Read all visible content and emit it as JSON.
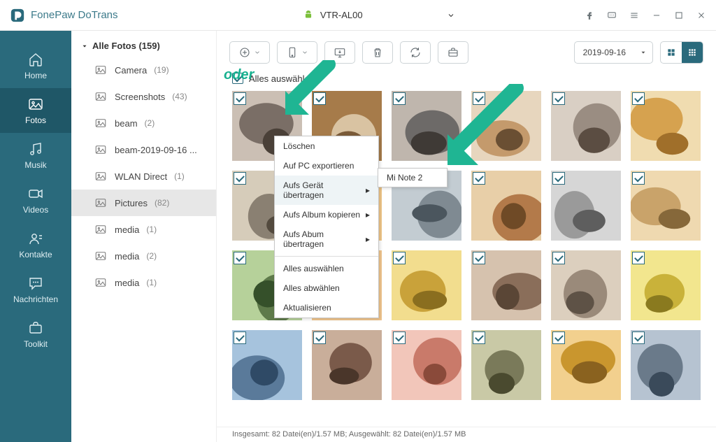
{
  "app": {
    "name": "FonePaw DoTrans"
  },
  "device": {
    "name": "VTR-AL00"
  },
  "nav": [
    {
      "id": "home",
      "label": "Home"
    },
    {
      "id": "fotos",
      "label": "Fotos"
    },
    {
      "id": "musik",
      "label": "Musik"
    },
    {
      "id": "videos",
      "label": "Videos"
    },
    {
      "id": "kontakte",
      "label": "Kontakte"
    },
    {
      "id": "nachrichten",
      "label": "Nachrichten"
    },
    {
      "id": "toolkit",
      "label": "Toolkit"
    }
  ],
  "albums": {
    "header": "Alle Fotos (159)",
    "items": [
      {
        "name": "Camera",
        "count": "(19)"
      },
      {
        "name": "Screenshots",
        "count": "(43)"
      },
      {
        "name": "beam",
        "count": "(2)"
      },
      {
        "name": "beam-2019-09-16 ...",
        "count": ""
      },
      {
        "name": "WLAN Direct",
        "count": "(1)"
      },
      {
        "name": "Pictures",
        "count": "(82)",
        "selected": true
      },
      {
        "name": "media",
        "count": "(1)"
      },
      {
        "name": "media",
        "count": "(2)"
      },
      {
        "name": "media",
        "count": "(1)"
      }
    ]
  },
  "toolbar": {
    "date": "2019-09-16"
  },
  "selectall": {
    "label": "Alles auswählen"
  },
  "context_menu": {
    "items": [
      "Löschen",
      "Auf PC exportieren",
      "Aufs Gerät übertragen",
      "Aufs Album kopieren",
      "Aufs Abum übertragen",
      "Alles auswählen",
      "Alles abwählen",
      "Aktualisieren"
    ],
    "submenu": [
      "Mi Note 2"
    ]
  },
  "status": "Insgesamt: 82 Datei(en)/1.57 MB; Ausgewählt: 82 Datei(en)/1.57 MB",
  "annotation": {
    "oder": "oder"
  }
}
